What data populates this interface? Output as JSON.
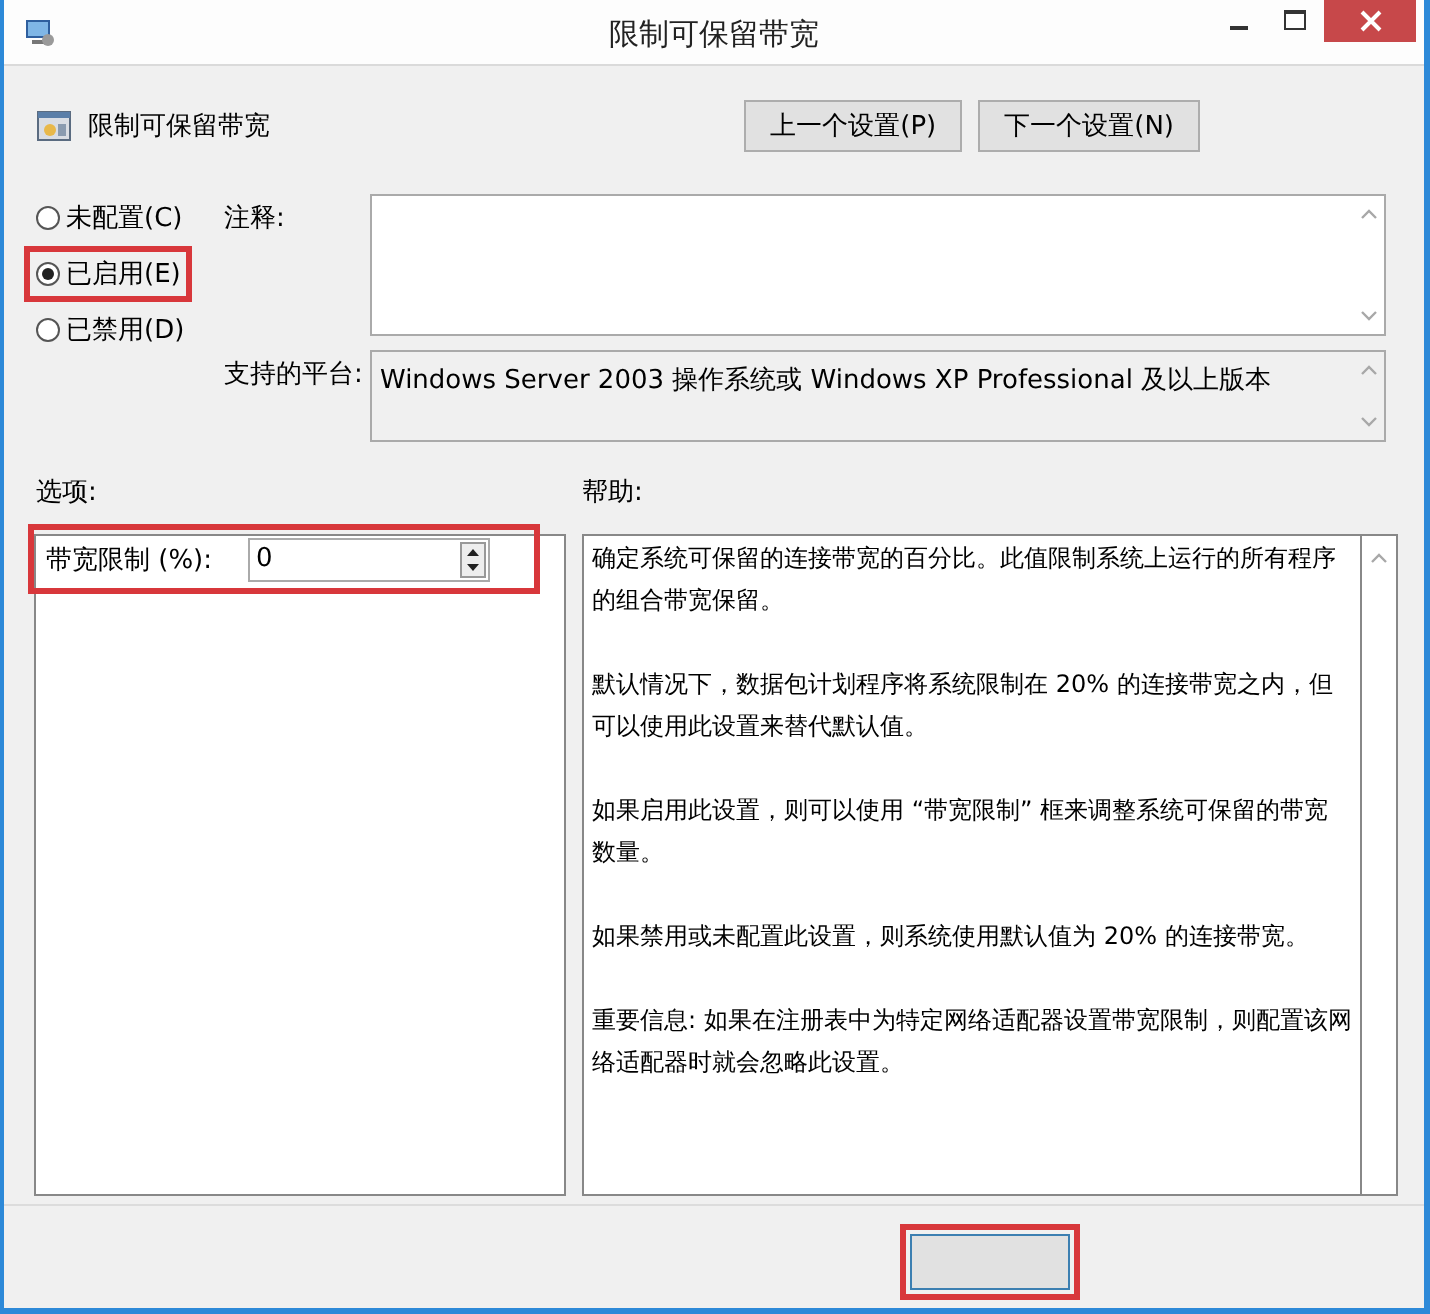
{
  "window": {
    "title": "限制可保留带宽"
  },
  "header": {
    "title": "限制可保留带宽"
  },
  "nav_buttons": [
    "上一个设置(P)",
    "下一个设置(N)"
  ],
  "state_options": [
    {
      "label": "未配置(C)",
      "selected": false,
      "highlighted": false
    },
    {
      "label": "已启用(E)",
      "selected": true,
      "highlighted": true
    },
    {
      "label": "已禁用(D)",
      "selected": false,
      "highlighted": false
    }
  ],
  "comment": {
    "label": "注释:"
  },
  "platform": {
    "label": "支持的平台:",
    "value": "Windows Server 2003 操作系统或 Windows XP Professional 及以上版本"
  },
  "options": {
    "label": "选项:",
    "fields": [
      {
        "label": "带宽限制 (%):",
        "value": "0",
        "highlighted": true
      }
    ]
  },
  "help": {
    "label": "帮助:",
    "paragraphs": [
      "确定系统可保留的连接带宽的百分比。此值限制系统上运行的所有程序的组合带宽保留。",
      "默认情况下，数据包计划程序将系统限制在 20% 的连接带宽之内，但可以使用此设置来替代默认值。",
      "如果启用此设置，则可以使用 “带宽限制” 框来调整系统可保留的带宽数量。",
      "如果禁用或未配置此设置，则系统使用默认值为 20% 的连接带宽。",
      "重要信息: 如果在注册表中为特定网络适配器设置带宽限制，则配置该网络适配器时就会忽略此设置。"
    ]
  },
  "footer_button": {
    "highlighted": true
  }
}
